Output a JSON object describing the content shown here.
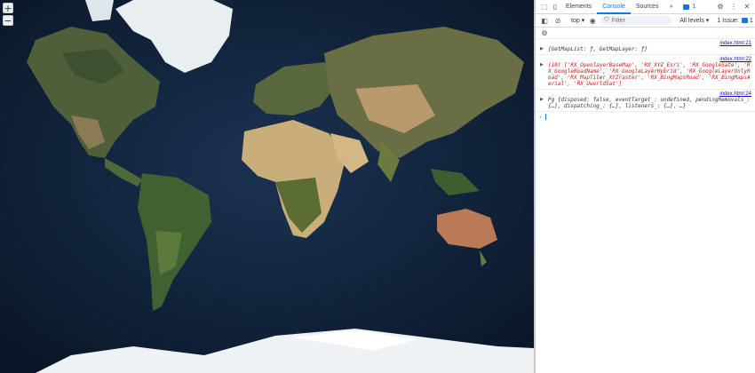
{
  "map": {
    "zoom_in": "+",
    "zoom_out": "−"
  },
  "devtools": {
    "tabs": [
      "Elements",
      "Console",
      "Sources"
    ],
    "more_tabs": "»",
    "issue_count": "1",
    "toolbar": {
      "context": "top ▾",
      "filter_placeholder": "Filter",
      "levels": "All levels ▾",
      "issues_label": "1 Issue:",
      "issues_count": "1"
    },
    "entries": [
      {
        "source": "index.html:21",
        "text": "{GetMapList: ƒ, GetMapLayer: ƒ}"
      },
      {
        "source": "index.html:22",
        "text": "(10) ['RX_OpenlayerBaseMap', 'RX_XYZ_Esri', 'RX_GoogleSate', 'RX_GoogleRoadName', 'RX_GoogleLayerHybrid', 'RX_GoogleLayerOnlyRoad', 'RX_MapTiler_XYZraster', 'RX_BingMapsRoad', 'RX_BingMapsAerial', 'RX_UworldSat']"
      },
      {
        "source": "index.html:24",
        "text": "Pg {disposed: false, eventTarget_: undefined, pendingRemovals_: {…}, dispatching_: {…}, listeners_: {…}, …}"
      }
    ],
    "prompt": "›"
  }
}
